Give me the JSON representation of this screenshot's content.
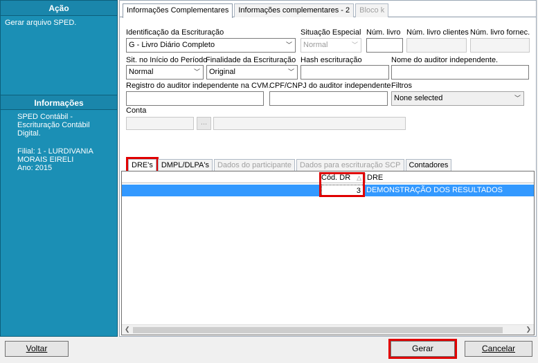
{
  "left_panel": {
    "action_header": "Ação",
    "action_text": "Gerar arquivo SPED.",
    "info_header": "Informações",
    "info_line1": "SPED Contábil - Escrituração Contábil Digital.",
    "info_filial": "Filial: 1 - LURDIVANIA MORAIS EIRELI",
    "info_ano": "Ano: 2015"
  },
  "top_tabs": [
    {
      "label": "Informações Complementares"
    },
    {
      "label": "Informações complementares - 2"
    },
    {
      "label": "Bloco k"
    }
  ],
  "form": {
    "identificacao_label": "Identificação da Escrituração",
    "identificacao_value": "G - Livro Diário Completo",
    "situacao_label": "Situação Especial",
    "situacao_value": "Normal",
    "num_livro_label": "Núm. livro",
    "num_livro_clientes_label": "Núm. livro clientes",
    "num_livro_fornec_label": "Núm. livro fornec.",
    "sit_inicio_label": "Sit. no Início do Período",
    "sit_inicio_value": "Normal",
    "finalidade_label": "Finalidade da Escrituração",
    "finalidade_value": "Original",
    "hash_label": "Hash escrituração",
    "auditor_nome_label": "Nome do auditor independente.",
    "auditor_cvm_label": "Registro do auditor independente na CVM.",
    "auditor_cpf_label": "CPF/CNPJ do auditor independente",
    "filtros_label": "Filtros",
    "filtros_value": "None selected",
    "conta_label": "Conta",
    "conta_button": "..."
  },
  "bottom_tabs": [
    {
      "label": "DRE's"
    },
    {
      "label": "DMPL/DLPA's"
    },
    {
      "label": "Dados do participante"
    },
    {
      "label": "Dados para escrituração SCP"
    },
    {
      "label": "Contadores"
    }
  ],
  "grid": {
    "col_cod": "Cód. DR",
    "col_dre": "DRE",
    "rows": [
      {
        "cod": "3",
        "dre": "DEMONSTRAÇÃO DOS RESULTADOS"
      }
    ]
  },
  "footer": {
    "voltar": "Voltar",
    "gerar": "Gerar",
    "cancelar": "Cancelar"
  }
}
